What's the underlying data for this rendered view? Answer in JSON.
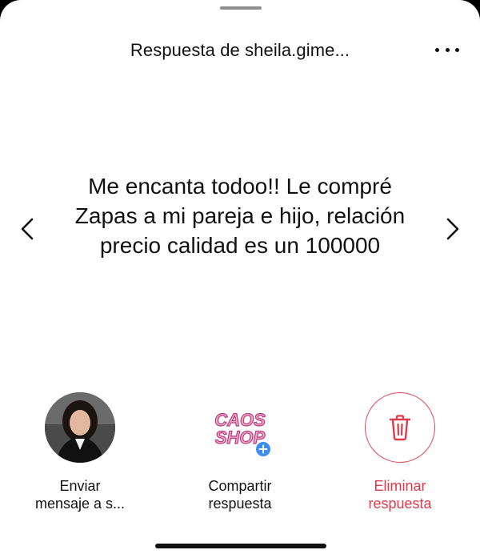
{
  "sheet": {
    "title": "Respuesta de sheila.gime..."
  },
  "message": {
    "text": "Me encanta todoo!! Le compré Zapas a mi pareja e hijo, relación precio calidad es un 100000"
  },
  "actions": [
    {
      "label_line1": "Enviar",
      "label_line2": "mensaje a s...",
      "icon": "avatar"
    },
    {
      "label_line1": "Compartir",
      "label_line2": "respuesta",
      "icon": "caos-shop-logo",
      "logo_text_1": "CAOS",
      "logo_text_2": "SHOP"
    },
    {
      "label_line1": "Eliminar",
      "label_line2": "respuesta",
      "icon": "trash-icon"
    }
  ],
  "colors": {
    "danger": "#e0394d",
    "badge": "#3d8cf0",
    "logo_pink": "#e86aa6"
  }
}
